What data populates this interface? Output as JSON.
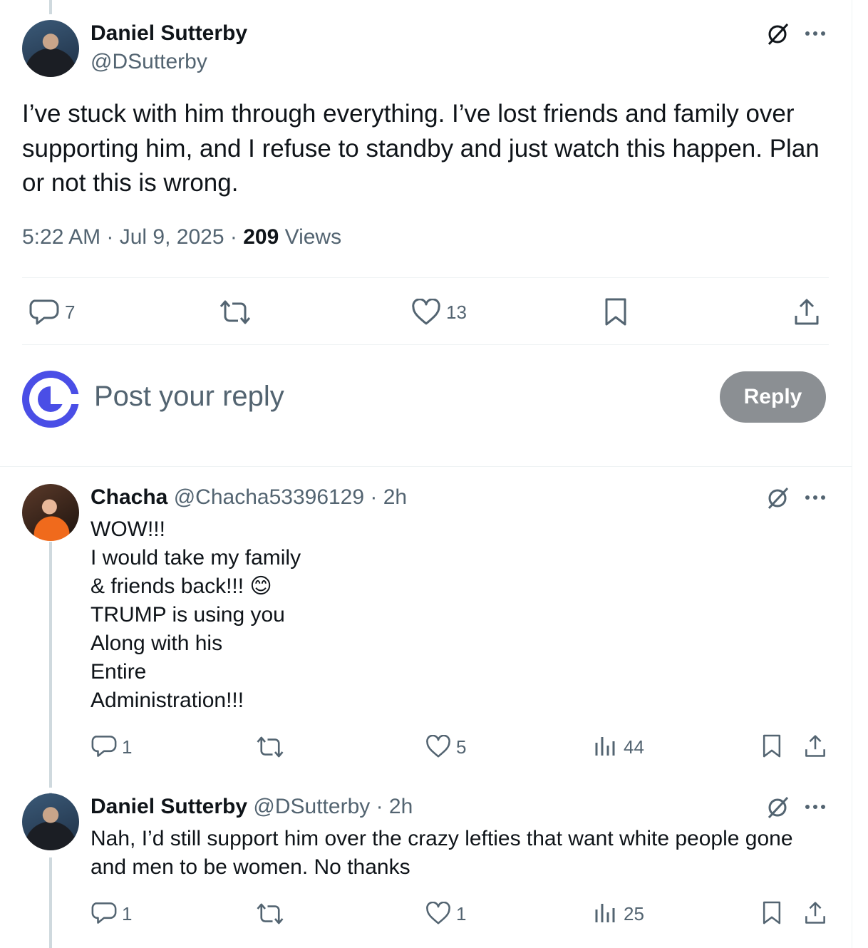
{
  "main_post": {
    "author_name": "Daniel Sutterby",
    "author_handle": "@DSutterby",
    "text": "I’ve stuck with him through everything. I’ve lost friends and family over supporting him, and I refuse to standby and just watch this happen. Plan or not this is wrong.",
    "time": "5:22 AM",
    "separator1": " · ",
    "date": "Jul 9, 2025",
    "separator2": " · ",
    "views_count": "209",
    "views_label": " Views",
    "actions": {
      "reply_count": "7",
      "repost_count": "",
      "like_count": "13"
    }
  },
  "compose": {
    "placeholder": "Post your reply",
    "button_label": "Reply"
  },
  "replies": [
    {
      "author_name": "Chacha",
      "author_handle": "@Chacha53396129",
      "time": " · 2h",
      "lines": [
        "WOW!!!",
        "I would take my family",
        "& friends back!!! 😊",
        "TRUMP is using you",
        "Along with his",
        "Entire",
        "Administration!!!"
      ],
      "reply_count": "1",
      "like_count": "5",
      "views_count": "44"
    },
    {
      "author_name": "Daniel Sutterby",
      "author_handle": "@DSutterby",
      "time": " · 2h",
      "lines": [
        "Nah, I’d still support him over the crazy lefties that want white people gone",
        "and men to be women. No thanks"
      ],
      "reply_count": "1",
      "like_count": "1",
      "views_count": "25"
    }
  ],
  "icons": [
    "grok-slash-icon",
    "more-icon",
    "reply-icon",
    "repost-icon",
    "like-icon",
    "bookmark-icon",
    "share-icon",
    "views-icon",
    "app-logo-icon"
  ],
  "colors": {
    "muted": "#536471",
    "text": "#0f1419",
    "reply_button": "#8b8f93",
    "logo": "#4a4ee6"
  }
}
